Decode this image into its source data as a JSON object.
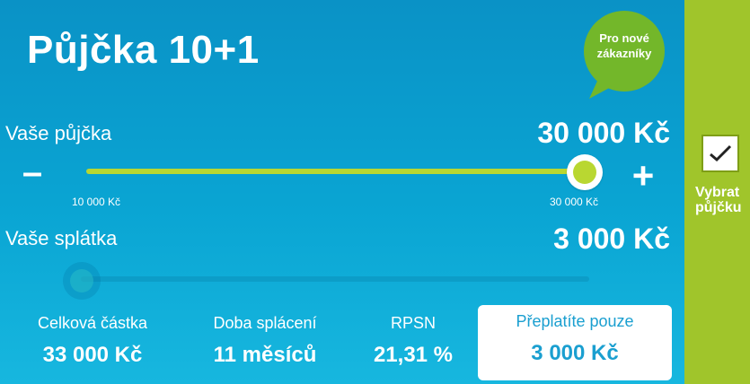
{
  "loan": {
    "title": "Půjčka 10+1",
    "badge": {
      "line1": "Pro nové",
      "line2": "zákazníky",
      "color": "#73b72a"
    },
    "amount": {
      "label": "Vaše půjčka",
      "value": "30 000 Kč",
      "min_label": "10 000 Kč",
      "max_label": "30 000 Kč",
      "minus": "–",
      "plus": "+",
      "fill_fraction": 1.0
    },
    "installment": {
      "label": "Vaše splátka",
      "value": "3 000 Kč",
      "fill_fraction": 0.0
    },
    "summary": [
      {
        "label": "Celková částka",
        "value": "33 000 Kč"
      },
      {
        "label": "Doba splácení",
        "value": "11 měsíců"
      },
      {
        "label": "RPSN",
        "value": "21,31 %"
      }
    ],
    "highlight": {
      "label": "Přeplatíte pouze",
      "value": "3 000 Kč"
    }
  },
  "select": {
    "line1": "Vybrat",
    "line2": "půjčku",
    "checked": true
  },
  "colors": {
    "panel_blue": "#0a9ccc",
    "accent_green": "#b9d731",
    "strip_green": "#a0c52b",
    "highlight_text": "#1a9fd0"
  }
}
